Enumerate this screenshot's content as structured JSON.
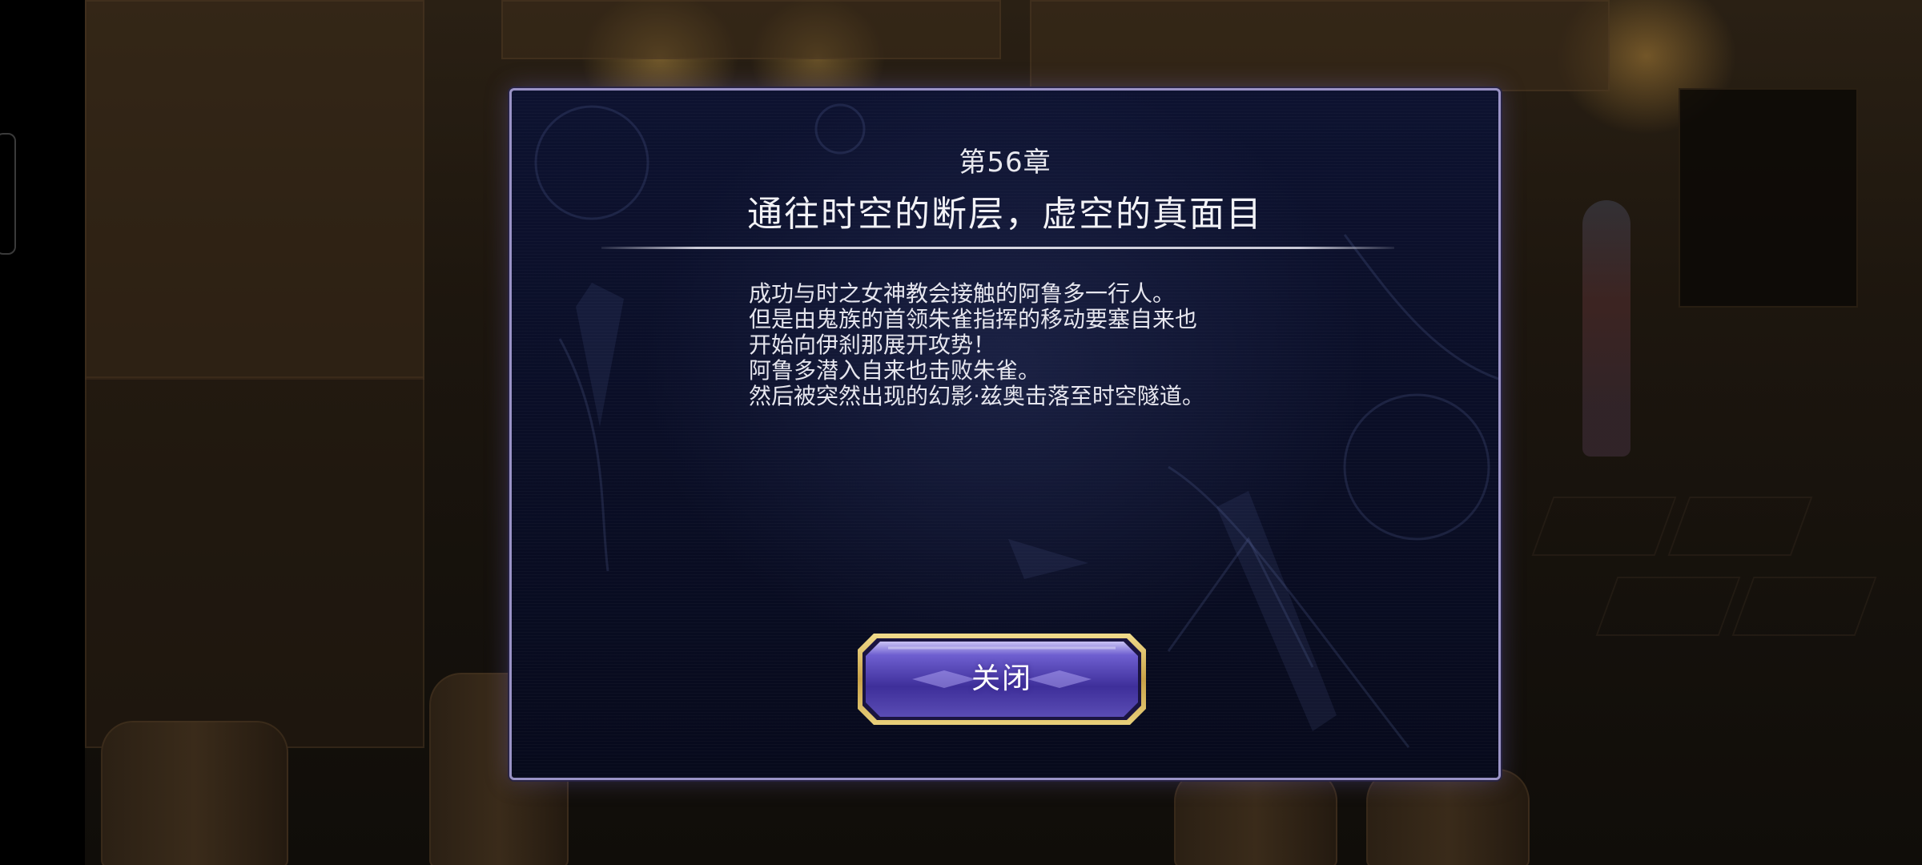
{
  "dialog": {
    "chapter_number": "第56章",
    "chapter_title": "通往时空的断层，虚空的真面目",
    "story_lines": [
      "成功与时之女神教会接触的阿鲁多一行人。",
      "但是由鬼族的首领朱雀指挥的移动要塞自来也",
      "开始向伊刹那展开攻势！",
      "阿鲁多潜入自来也击败朱雀。",
      "然后被突然出现的幻影·兹奥击落至时空隧道。"
    ],
    "close_button_label": "关闭"
  },
  "colors": {
    "dialog_border": "#9a93c6",
    "button_gold": "#d9b85a",
    "button_purple": "#5b4bb8",
    "text": "#e6e6ee"
  }
}
